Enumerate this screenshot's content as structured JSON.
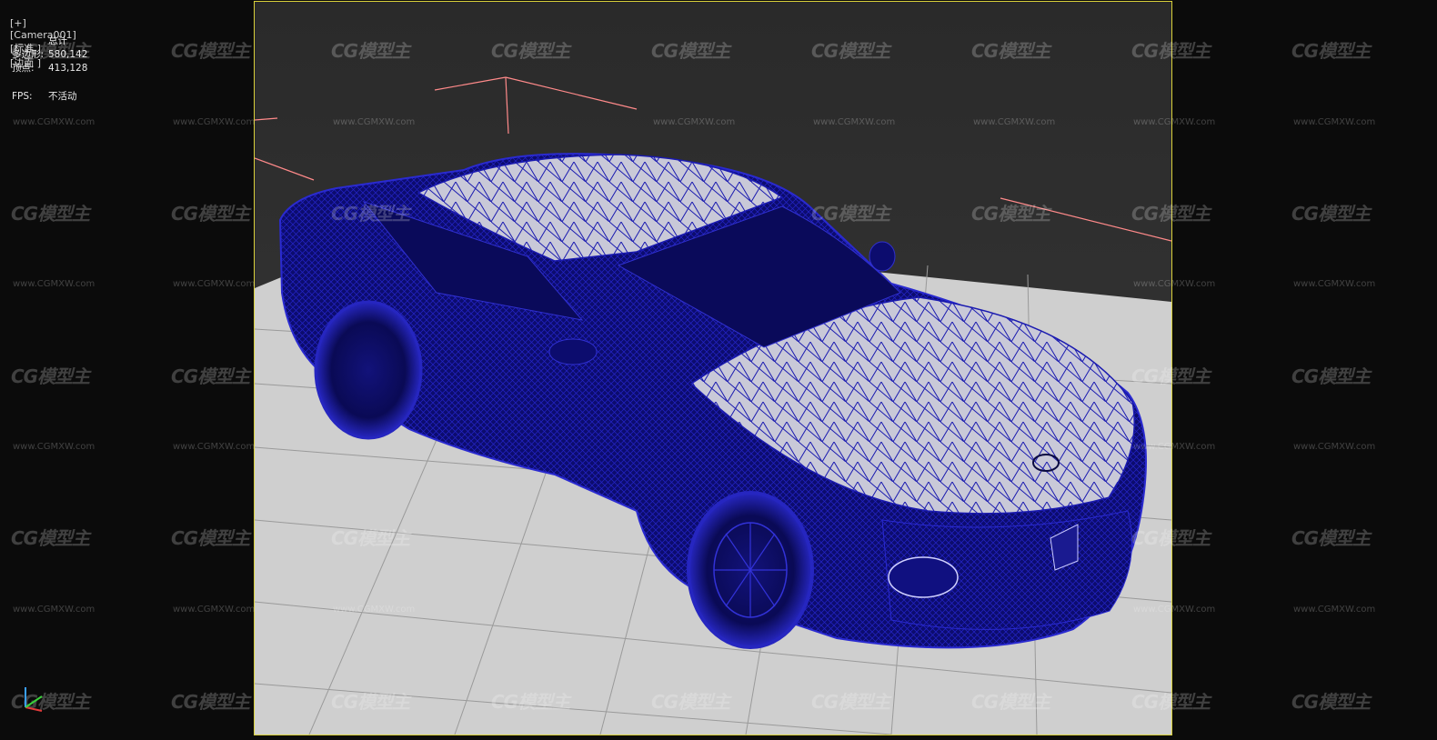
{
  "viewport": {
    "menu": [
      "[+]",
      "[Camera001]",
      "[标准 ]",
      "[边面 ]"
    ]
  },
  "stats": {
    "header": "总计",
    "polygons_label": "多边形:",
    "polygons_value": "580,142",
    "vertices_label": "顶点:",
    "vertices_value": "413,128",
    "fps_label": "FPS:",
    "fps_value": "不活动"
  },
  "watermark": {
    "logo": "CG模型主",
    "url": "www.CGMXW.com"
  },
  "colors": {
    "frame_border": "#d8cf3a",
    "wireframe": "#1a1ab0",
    "grid_line": "#ff8a8a"
  }
}
